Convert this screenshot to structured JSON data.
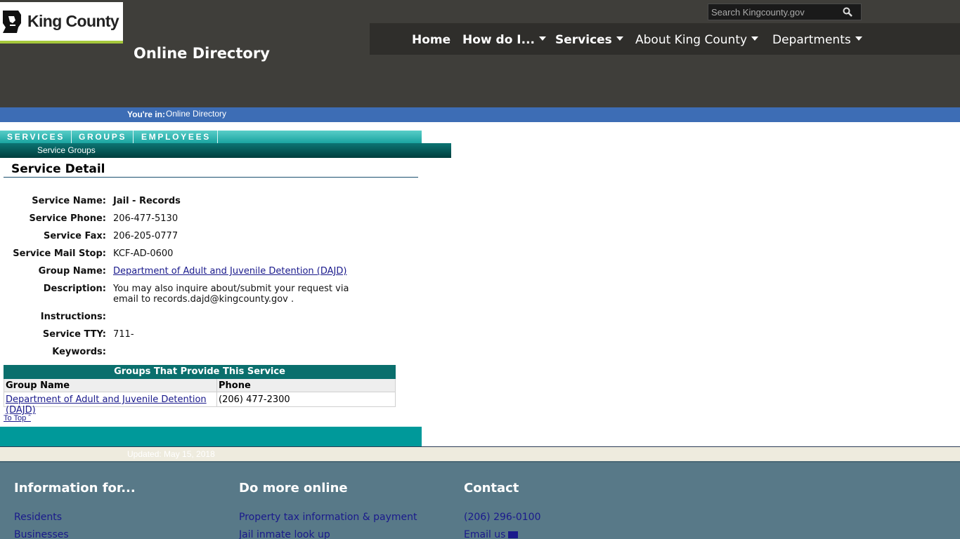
{
  "header": {
    "logo_text": "King County",
    "site_title": "Online Directory",
    "search_placeholder": "Search Kingcounty.gov",
    "nav": [
      "Home",
      "How do I...",
      "Services",
      "About King County",
      "Departments"
    ]
  },
  "breadcrumb": {
    "label": "You're in:",
    "value": "Online Directory"
  },
  "tabs": [
    "SERVICES",
    "GROUPS",
    "EMPLOYEES"
  ],
  "subnav": {
    "service_groups": "Service Groups"
  },
  "detail": {
    "title": "Service Detail",
    "rows": [
      {
        "label": "Service Name:",
        "value": "Jail - Records"
      },
      {
        "label": "Service Phone:",
        "value": "206-477-5130"
      },
      {
        "label": "Service Fax:",
        "value": "206-205-0777"
      },
      {
        "label": "Service Mail Stop:",
        "value": "KCF-AD-0600"
      },
      {
        "label": "Group Name:",
        "value": "Department of Adult and Juvenile Detention (DAJD)"
      },
      {
        "label": "Description:",
        "value": "You may also inquire about/submit your request via email to records.dajd@kingcounty.gov ."
      },
      {
        "label": "Instructions:",
        "value": ""
      },
      {
        "label": "Service TTY:",
        "value": "711-"
      },
      {
        "label": "Keywords:",
        "value": ""
      }
    ]
  },
  "groups_table": {
    "title": "Groups That Provide This Service",
    "columns": [
      "Group Name",
      "Phone"
    ],
    "rows": [
      {
        "group": "Department of Adult and Juvenile Detention (DAJD)",
        "phone": "(206) 477-2300"
      }
    ]
  },
  "to_top": "To Top ˆ",
  "updated": "Updated: May 15, 2018",
  "footer": {
    "col1": {
      "title": "Information for...",
      "links": [
        "Residents",
        "Businesses"
      ]
    },
    "col2": {
      "title": "Do more online",
      "links": [
        "Property tax information & payment",
        "Jail inmate look up"
      ]
    },
    "col3": {
      "title": "Contact",
      "links": [
        "(206) 296-0100",
        "Email us"
      ]
    }
  }
}
